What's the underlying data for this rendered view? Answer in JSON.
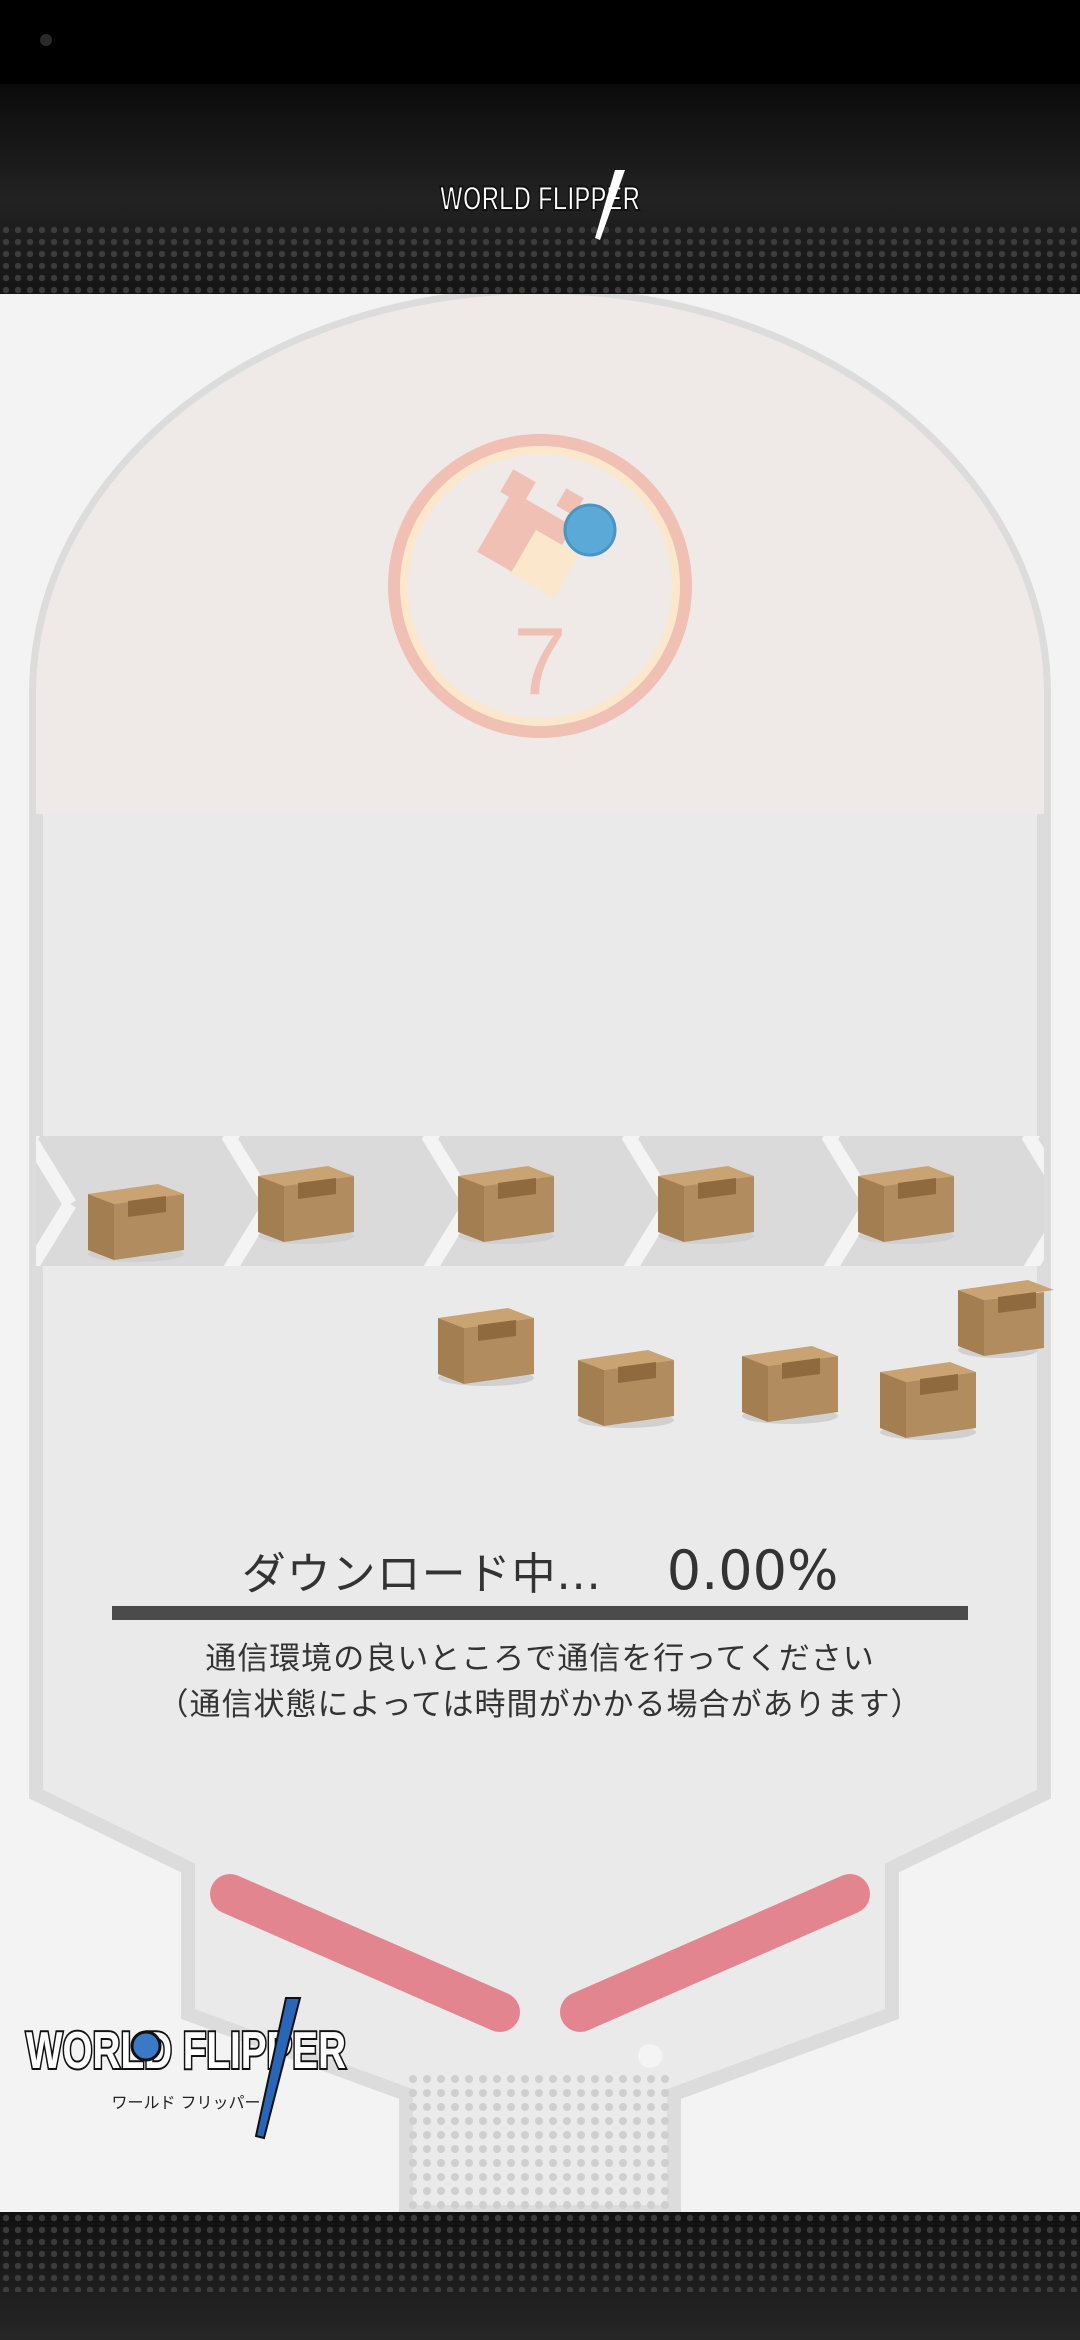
{
  "header": {
    "logo_text": "WORLD FLIPPER"
  },
  "target": {
    "counter": "7"
  },
  "download": {
    "label": "ダウンロード中...",
    "percent_text": "0.00%",
    "progress_fraction": 0.0
  },
  "notice": {
    "line1": "通信環境の良いところで通信を行ってください",
    "line2": "（通信状態によっては時間がかかる場合があります）"
  },
  "footer_logo": {
    "text": "WORLD FLIPPER",
    "sub": "ワールド フリッパー"
  },
  "colors": {
    "accent": "#6fc4ea",
    "flipper": "#e3858f",
    "target_ring": "#efc0b3",
    "box": "#b18c5e"
  }
}
